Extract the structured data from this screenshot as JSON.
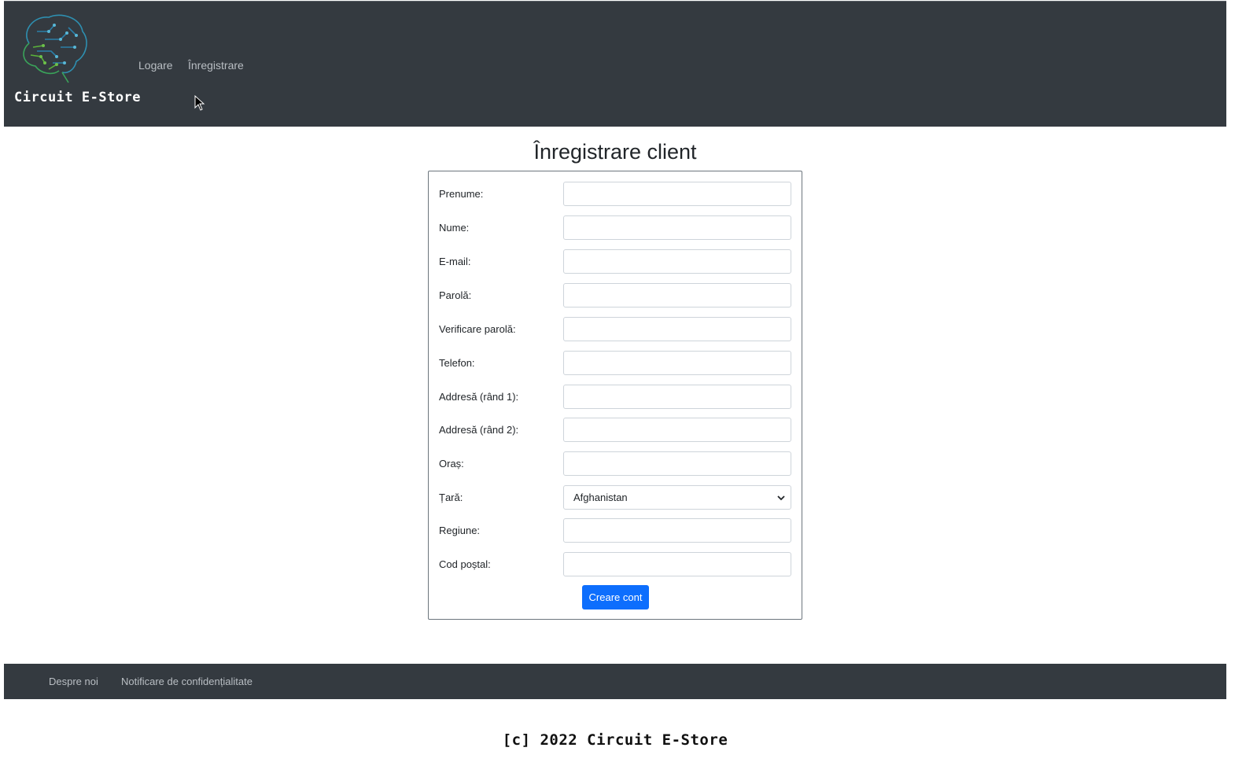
{
  "header": {
    "brand": "Circuit E-Store",
    "nav": [
      {
        "label": "Logare"
      },
      {
        "label": "Înregistrare"
      }
    ]
  },
  "page_title": "Înregistrare client",
  "form": {
    "fields": [
      {
        "label": "Prenume:",
        "value": ""
      },
      {
        "label": "Nume:",
        "value": ""
      },
      {
        "label": "E-mail:",
        "value": ""
      },
      {
        "label": "Parolă:",
        "value": ""
      },
      {
        "label": "Verificare parolă:",
        "value": ""
      },
      {
        "label": "Telefon:",
        "value": ""
      },
      {
        "label": "Addresă (rând 1):",
        "value": ""
      },
      {
        "label": "Addresă (rând 2):",
        "value": ""
      },
      {
        "label": "Oraș:",
        "value": ""
      },
      {
        "label": "Țară:",
        "selected": "Afghanistan"
      },
      {
        "label": "Regiune:",
        "value": ""
      },
      {
        "label": "Cod poștal:",
        "value": ""
      }
    ],
    "submit_label": "Creare cont"
  },
  "footer": {
    "links": [
      {
        "label": "Despre noi"
      },
      {
        "label": "Notificare de confidențialitate"
      }
    ],
    "copyright": "[c] 2022 Circuit E-Store"
  },
  "colors": {
    "header_bg": "#343a40",
    "accent": "#0d6efd",
    "nav_text": "#b9bec3"
  }
}
